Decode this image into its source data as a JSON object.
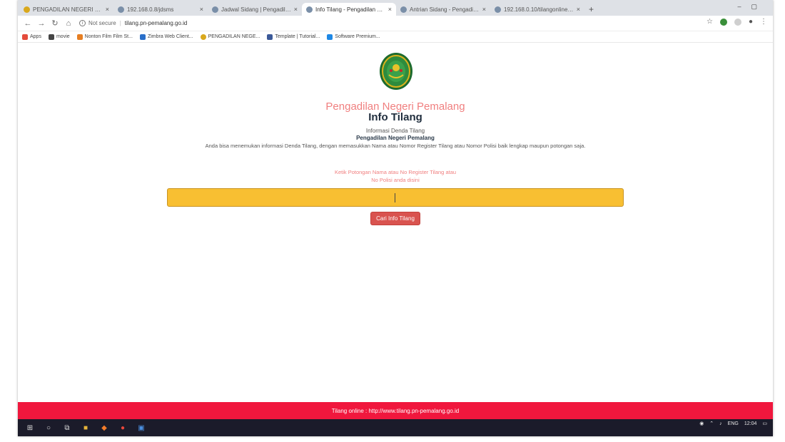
{
  "browser": {
    "tabs": [
      {
        "title": "PENGADILAN NEGERI PEMALA",
        "active": false
      },
      {
        "title": "192.168.0.8/jdsms",
        "active": false
      },
      {
        "title": "Jadwal Sidang | Pengadilan Ne",
        "active": false
      },
      {
        "title": "Info Tilang - Pengadilan Neger",
        "active": true
      },
      {
        "title": "Antrian Sidang - Pengadilan Ne",
        "active": false
      },
      {
        "title": "192.168.0.10/tilangonline/adm",
        "active": false
      }
    ],
    "new_tab_label": "+",
    "not_secure_label": "Not secure",
    "url": "tilang.pn-pemalang.go.id",
    "bookmarks": [
      {
        "label": "Apps",
        "color": "#e44b3b"
      },
      {
        "label": "movie",
        "color": "#444444"
      },
      {
        "label": "Nonton Film Film St...",
        "color": "#e67e22"
      },
      {
        "label": "Zimbra Web Client...",
        "color": "#2a6fc9"
      },
      {
        "label": "PENGADILAN NEGE...",
        "color": "#d9a81c"
      },
      {
        "label": "Template | Tutorial...",
        "color": "#3b5998"
      },
      {
        "label": "Software Premium...",
        "color": "#1e88e5"
      }
    ]
  },
  "page": {
    "site_name": "Pengadilan Negeri Pemalang",
    "title": "Info Tilang",
    "subtitle": "Informasi Denda Tilang",
    "court": "Pengadilan Negeri Pemalang",
    "description": "Anda bisa menemukan informasi Denda Tilang, dengan memasukkan Nama atau Nomor Register Tilang atau Nomor Polisi baik lengkap maupun potongan saja.",
    "hint_line1": "Ketik Potongan Nama atau No Register Tilang atau",
    "hint_line2": "No Polisi anda disini",
    "search_value": "",
    "search_button": "Cari Info Tilang",
    "footer": "Tilang online : http://www.tilang.pn-pemalang.go.id"
  },
  "taskbar": {
    "lang": "ENG",
    "time": "12:04"
  },
  "colors": {
    "accent_red": "#f0173d",
    "search_bg": "#f8bf32",
    "button": "#d9534f",
    "site_name": "#f07f7f"
  }
}
